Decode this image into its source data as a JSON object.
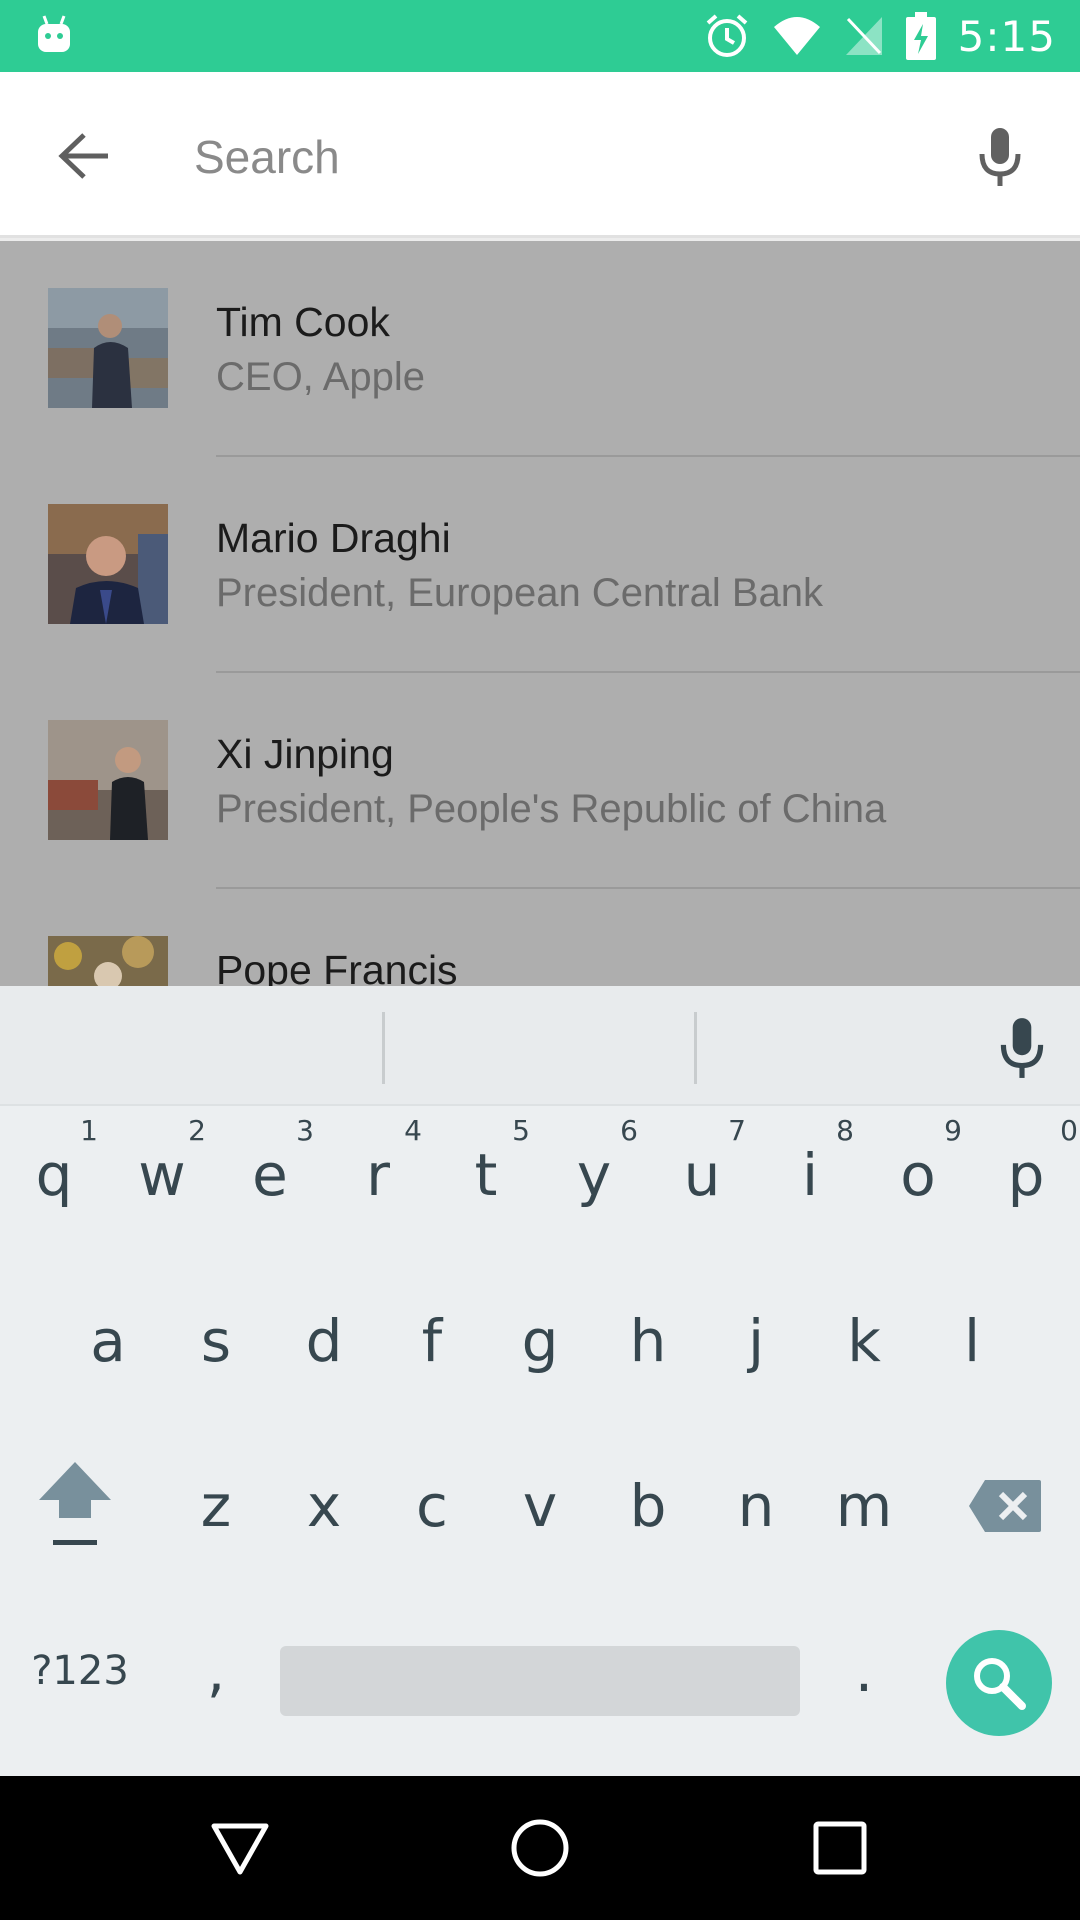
{
  "status_bar": {
    "time": "5:15",
    "icons": [
      "android-debug-icon",
      "alarm-icon",
      "wifi-icon",
      "no-sim-icon",
      "battery-charging-icon"
    ],
    "background_color": "#2ecc94"
  },
  "search": {
    "placeholder": "Search",
    "value": ""
  },
  "results": [
    {
      "name": "Tim Cook",
      "title": "CEO, Apple"
    },
    {
      "name": "Mario Draghi",
      "title": "President, European Central Bank"
    },
    {
      "name": "Xi Jinping",
      "title": "President, People's Republic of China"
    },
    {
      "name": "Pope Francis",
      "title": ""
    }
  ],
  "keyboard": {
    "row1": [
      {
        "label": "q",
        "hint": "1"
      },
      {
        "label": "w",
        "hint": "2"
      },
      {
        "label": "e",
        "hint": "3"
      },
      {
        "label": "r",
        "hint": "4"
      },
      {
        "label": "t",
        "hint": "5"
      },
      {
        "label": "y",
        "hint": "6"
      },
      {
        "label": "u",
        "hint": "7"
      },
      {
        "label": "i",
        "hint": "8"
      },
      {
        "label": "o",
        "hint": "9"
      },
      {
        "label": "p",
        "hint": "0"
      }
    ],
    "row2": [
      "a",
      "s",
      "d",
      "f",
      "g",
      "h",
      "j",
      "k",
      "l"
    ],
    "row3": [
      "z",
      "x",
      "c",
      "v",
      "b",
      "n",
      "m"
    ],
    "symbols_label": "?123",
    "comma_label": ",",
    "period_label": ".",
    "accent_color": "#40c4aa"
  }
}
